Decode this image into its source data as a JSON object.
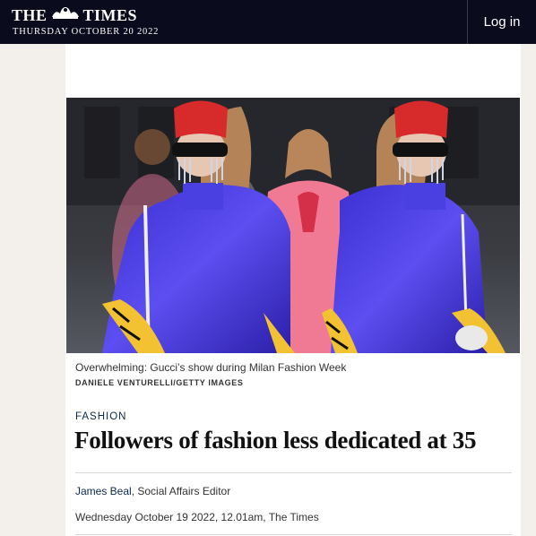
{
  "masthead": {
    "brand_left": "THE",
    "brand_right": "TIMES",
    "date": "THURSDAY OCTOBER 20 2022",
    "login_label": "Log in",
    "crest_icon": "royal-crest-icon",
    "background": "#0b0b1e"
  },
  "article": {
    "image_caption": "Overwhelming: Gucci’s show during Milan Fashion Week",
    "image_credit": "DANIELE VENTURELLI/GETTY IMAGES",
    "section": "FASHION",
    "headline": "Followers of fashion less dedicated at 35",
    "author": "James Beal",
    "author_role": ", Social Affairs Editor",
    "published": "Wednesday October 19 2022, 12.01am, The Times",
    "link_color": "#0b2a4a"
  }
}
